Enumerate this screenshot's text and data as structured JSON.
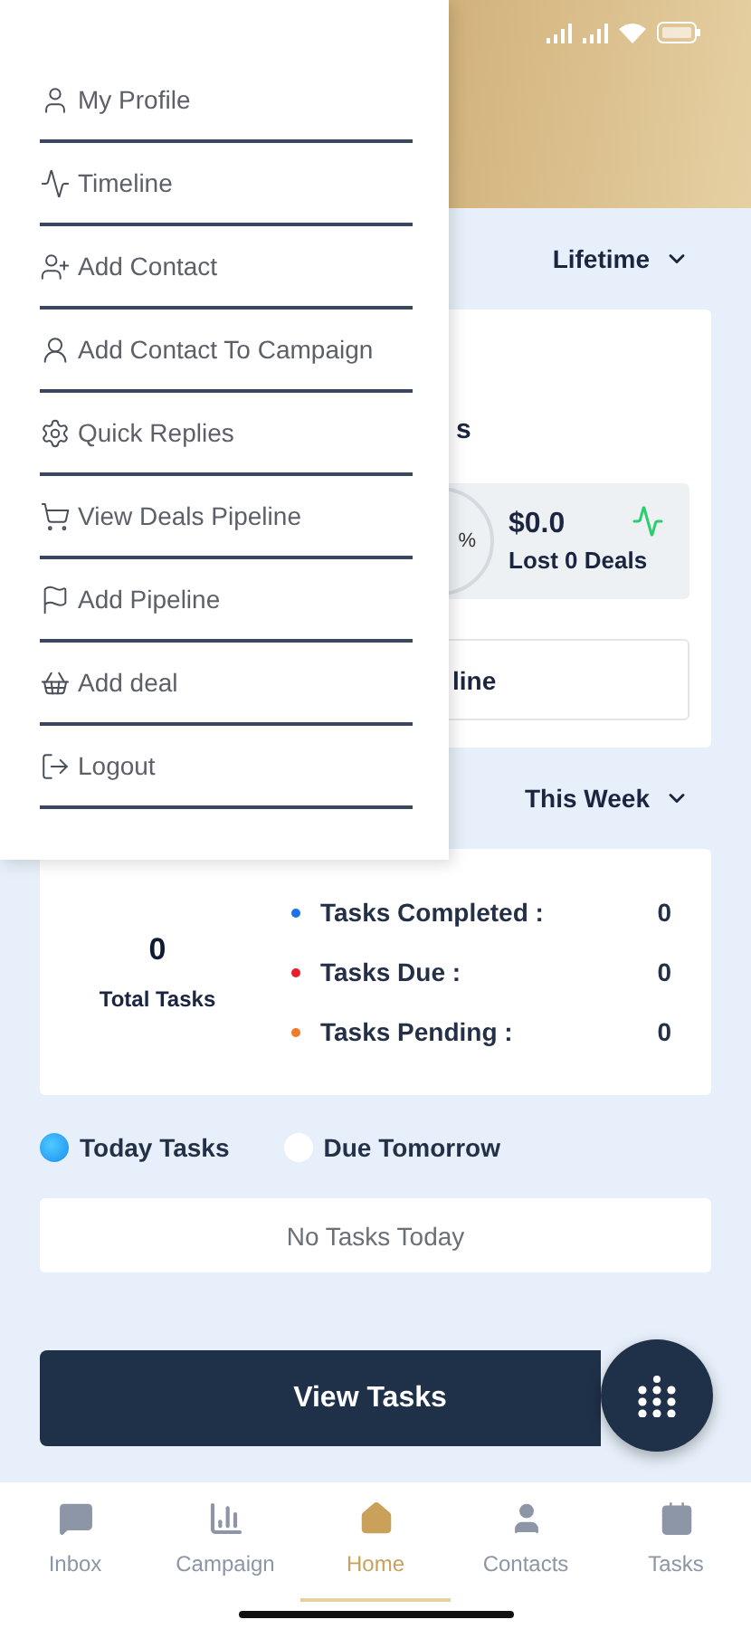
{
  "drawer": {
    "items": [
      {
        "label": "My Profile"
      },
      {
        "label": "Timeline"
      },
      {
        "label": "Add Contact"
      },
      {
        "label": "Add Contact To Campaign"
      },
      {
        "label": "Quick Replies"
      },
      {
        "label": "View Deals Pipeline"
      },
      {
        "label": "Add Pipeline"
      },
      {
        "label": "Add deal"
      },
      {
        "label": "Logout"
      }
    ]
  },
  "overview": {
    "period": "Lifetime",
    "title_fragment": "s",
    "percent_fragment": "%",
    "amount": "$0.0",
    "caption": "Lost 0 Deals",
    "link_fragment": "line"
  },
  "tasks": {
    "period": "This Week",
    "total": "0",
    "total_label": "Total Tasks",
    "stats": [
      {
        "label": "Tasks Completed :",
        "value": "0",
        "color": "#1a73e8"
      },
      {
        "label": "Tasks Due :",
        "value": "0",
        "color": "#e8202b"
      },
      {
        "label": "Tasks Pending :",
        "value": "0",
        "color": "#f07a2a"
      }
    ]
  },
  "task_tabs": [
    {
      "label": "Today Tasks",
      "selected": true
    },
    {
      "label": "Due Tomorrow",
      "selected": false
    }
  ],
  "empty_message": "No Tasks Today",
  "view_button": "View Tasks",
  "nav": [
    {
      "label": "Inbox",
      "selected": false
    },
    {
      "label": "Campaign",
      "selected": false
    },
    {
      "label": "Home",
      "selected": true
    },
    {
      "label": "Contacts",
      "selected": false
    },
    {
      "label": "Tasks",
      "selected": false
    }
  ]
}
